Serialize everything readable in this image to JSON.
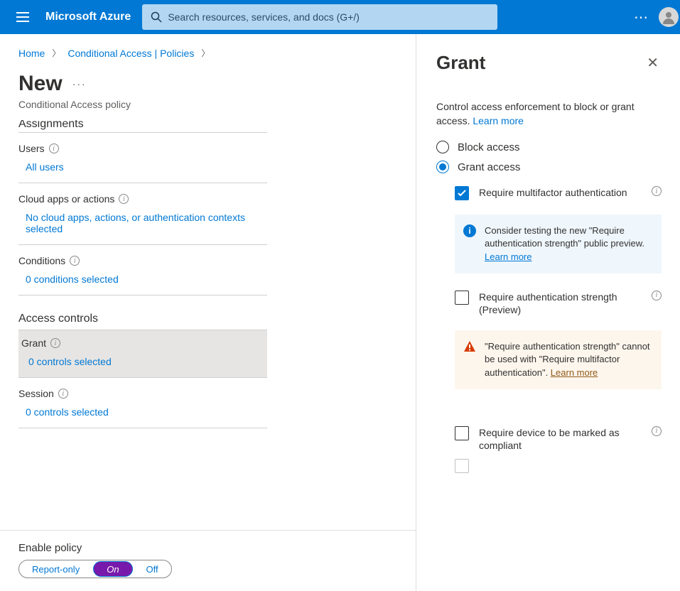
{
  "topbar": {
    "brand": "Microsoft Azure",
    "search_placeholder": "Search resources, services, and docs (G+/)"
  },
  "breadcrumb": {
    "home": "Home",
    "ca": "Conditional Access | Policies"
  },
  "page": {
    "title": "New",
    "subtitle": "Conditional Access policy",
    "assignments_cut": "Assignments"
  },
  "fields": {
    "users_label": "Users",
    "users_value": "All users",
    "apps_label": "Cloud apps or actions",
    "apps_value": "No cloud apps, actions, or authentication contexts selected",
    "conditions_label": "Conditions",
    "conditions_value": "0 conditions selected",
    "access_heading": "Access controls",
    "grant_label": "Grant",
    "grant_value": "0 controls selected",
    "session_label": "Session",
    "session_value": "0 controls selected"
  },
  "enable": {
    "label": "Enable policy",
    "opt_report": "Report-only",
    "opt_on": "On",
    "opt_off": "Off"
  },
  "panel": {
    "title": "Grant",
    "desc_text": "Control access enforcement to block or grant access. ",
    "learn_more": "Learn more",
    "radio_block": "Block access",
    "radio_grant": "Grant access",
    "chk_mfa": "Require multifactor authentication",
    "info_callout": "Consider testing the new \"Require authentication strength\" public preview.",
    "chk_strength": "Require authentication strength (Preview)",
    "warn_callout_a": "\"Require authentication strength\" cannot be used with \"Require multifactor authentication\". ",
    "chk_compliant": "Require device to be marked as compliant"
  }
}
